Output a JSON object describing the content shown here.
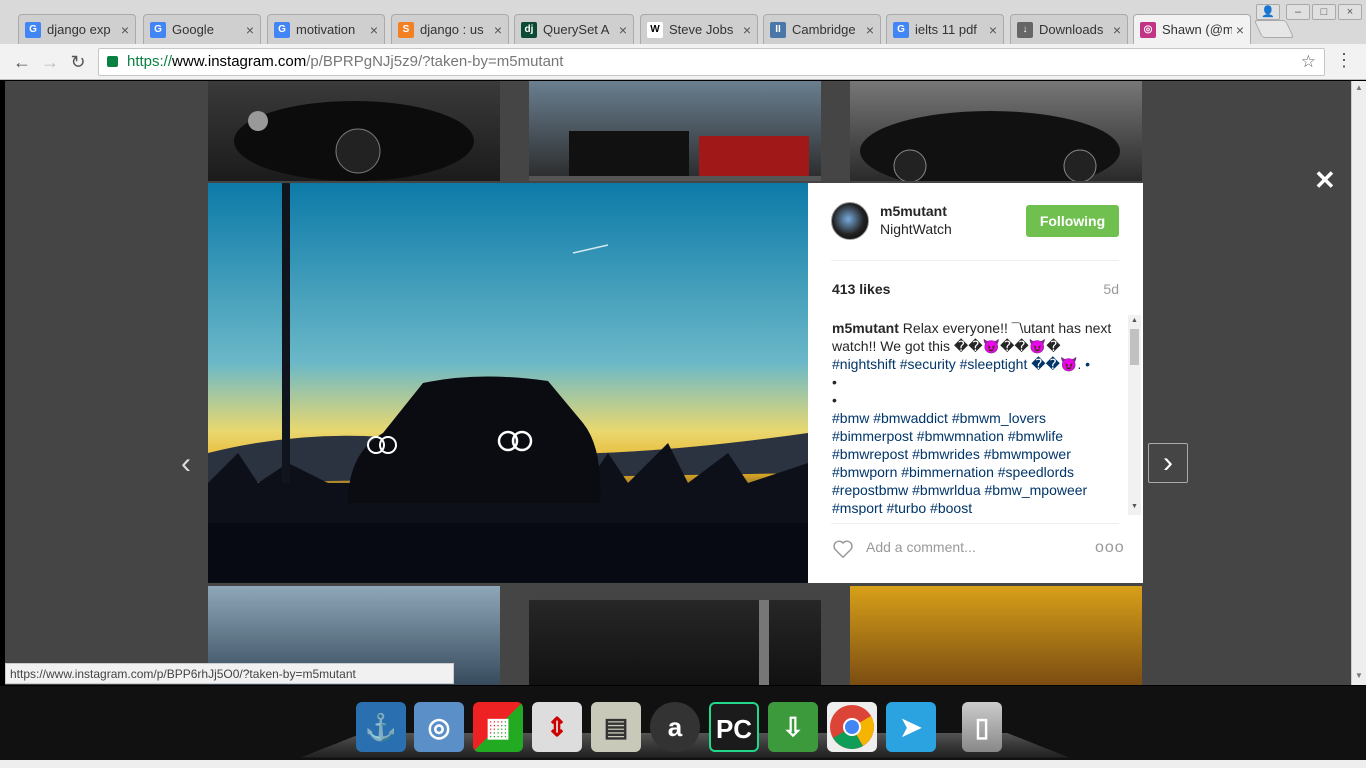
{
  "browser": {
    "tabs": [
      {
        "label": "django exp",
        "favicon_color": "#4285f4",
        "favicon_glyph": "G"
      },
      {
        "label": "Google",
        "favicon_color": "#4285f4",
        "favicon_glyph": "G"
      },
      {
        "label": "motivation",
        "favicon_color": "#4285f4",
        "favicon_glyph": "G"
      },
      {
        "label": "django : us",
        "favicon_color": "#f48024",
        "favicon_glyph": "S"
      },
      {
        "label": "QuerySet A",
        "favicon_color": "#0c4b33",
        "favicon_glyph": "dj"
      },
      {
        "label": "Steve Jobs",
        "favicon_color": "#ffffff",
        "favicon_glyph": "W"
      },
      {
        "label": "Cambridge",
        "favicon_color": "#4a76a8",
        "favicon_glyph": "II"
      },
      {
        "label": "ielts 11 pdf",
        "favicon_color": "#4285f4",
        "favicon_glyph": "G"
      },
      {
        "label": "Downloads",
        "favicon_color": "#666666",
        "favicon_glyph": "↓"
      },
      {
        "label": "Shawn (@m",
        "favicon_color": "#c13584",
        "favicon_glyph": "◎"
      }
    ],
    "address": {
      "scheme": "https://",
      "host": "www.instagram.com",
      "path": "/p/BPRPgNJj5z9/?taken-by=m5mutant"
    },
    "status_url": "https://www.instagram.com/p/BPP6rhJj5O0/?taken-by=m5mutant"
  },
  "post": {
    "username": "m5mutant",
    "location": "NightWatch",
    "follow_label": "Following",
    "likes": "413 likes",
    "age": "5d",
    "caption_user": "m5mutant",
    "caption_text": "Relax everyone!! ¯\\utant has next watch!! We got this ��😈��😈� ",
    "caption_tags_1": "#nightshift #security #sleeptight ��😈. •",
    "caption_dot_1": "•",
    "caption_dot_2": "•",
    "caption_tags_2": "#bmw #bmwaddict #bmwm_lovers #bimmerpost #bmwmnation #bmwlife #bmwrepost #bmwrides #bmwmpower #bmwporn #bimmernation #speedlords #repostbmw #bmwrlduа #bmw_mpoweer #msport #turbo #boost",
    "comment_placeholder": "Add a comment...",
    "more_label": "ooo",
    "close_label": "✕",
    "prev_label": "‹",
    "next_label": "›"
  },
  "colors": {
    "follow_button": "#70c050",
    "hashtag": "#003569"
  }
}
